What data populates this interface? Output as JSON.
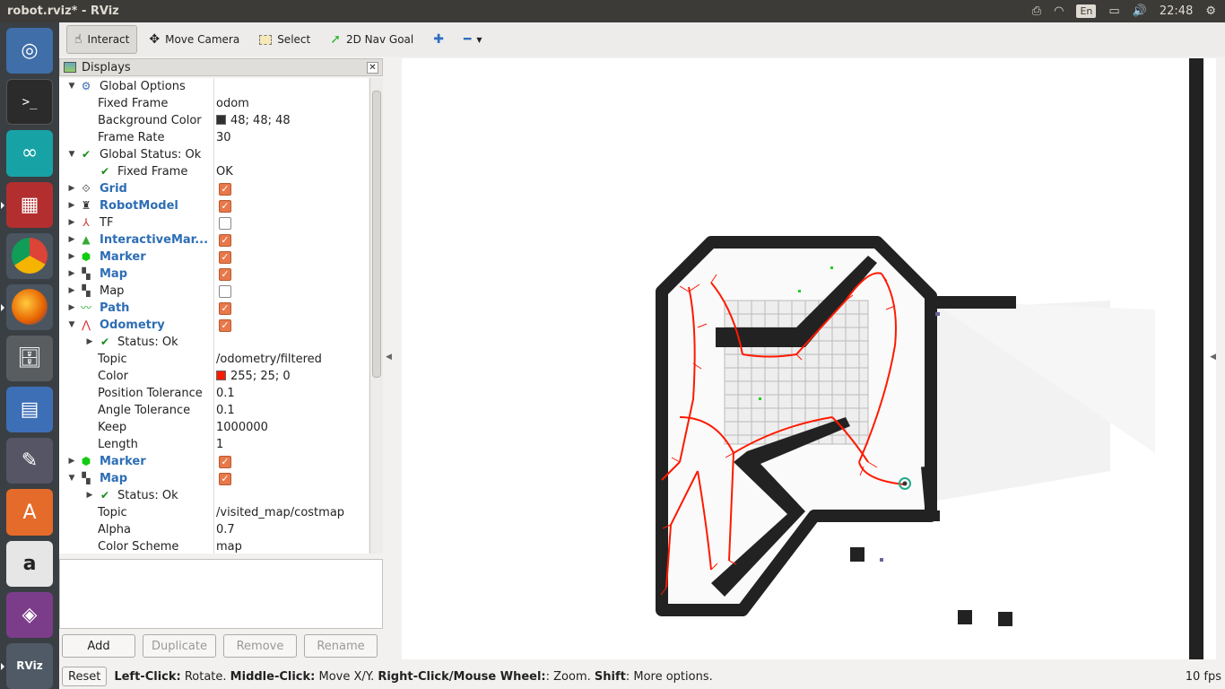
{
  "window": {
    "title": "robot.rviz* - RViz"
  },
  "tray": {
    "lang": "En",
    "clock": "22:48"
  },
  "toolbar": {
    "tools": [
      {
        "label": "Interact",
        "icon": "hand-icon"
      },
      {
        "label": "Move Camera",
        "icon": "move-camera-icon"
      },
      {
        "label": "Select",
        "icon": "select-icon"
      },
      {
        "label": "2D Nav Goal",
        "icon": "nav-goal-icon"
      }
    ]
  },
  "displays": {
    "title": "Displays",
    "rows": [
      {
        "name": "Global Options",
        "value": ""
      },
      {
        "name": "Fixed Frame",
        "value": "odom"
      },
      {
        "name": "Background Color",
        "value": "48; 48; 48",
        "swatch": "#303030"
      },
      {
        "name": "Frame Rate",
        "value": "30"
      },
      {
        "name": "Global Status: Ok",
        "value": ""
      },
      {
        "name": "Fixed Frame",
        "value": "OK"
      },
      {
        "name": "Grid",
        "checked": true
      },
      {
        "name": "RobotModel",
        "checked": true
      },
      {
        "name": "TF",
        "checked": false
      },
      {
        "name": "InteractiveMar...",
        "checked": true
      },
      {
        "name": "Marker",
        "checked": true
      },
      {
        "name": "Map",
        "checked": true
      },
      {
        "name": "Map",
        "checked": false
      },
      {
        "name": "Path",
        "checked": true
      },
      {
        "name": "Odometry",
        "checked": true
      },
      {
        "name": "Status: Ok",
        "value": ""
      },
      {
        "name": "Topic",
        "value": "/odometry/filtered"
      },
      {
        "name": "Color",
        "value": "255; 25; 0",
        "swatch": "#ff1900"
      },
      {
        "name": "Position Tolerance",
        "value": "0.1"
      },
      {
        "name": "Angle Tolerance",
        "value": "0.1"
      },
      {
        "name": "Keep",
        "value": "1000000"
      },
      {
        "name": "Length",
        "value": "1"
      },
      {
        "name": "Marker",
        "checked": true
      },
      {
        "name": "Map",
        "checked": true
      },
      {
        "name": "Status: Ok",
        "value": ""
      },
      {
        "name": "Topic",
        "value": "/visited_map/costmap"
      },
      {
        "name": "Alpha",
        "value": "0.7"
      },
      {
        "name": "Color Scheme",
        "value": "map"
      }
    ]
  },
  "buttons": {
    "add": "Add",
    "duplicate": "Duplicate",
    "remove": "Remove",
    "rename": "Rename"
  },
  "status": {
    "reset": "Reset",
    "hint_parts": [
      {
        "bold": "Left-Click:",
        "text": " Rotate. "
      },
      {
        "bold": "Middle-Click:",
        "text": " Move X/Y. "
      },
      {
        "bold": "Right-Click/Mouse Wheel:",
        "text": ": Zoom. "
      },
      {
        "bold": "Shift",
        "text": ": More options."
      }
    ],
    "fps": "10 fps"
  },
  "colors": {
    "odometry_path": "#ff1900",
    "wall": "#222222",
    "checkbox_on": "#e8784a",
    "link_blue": "#2d6db5"
  }
}
